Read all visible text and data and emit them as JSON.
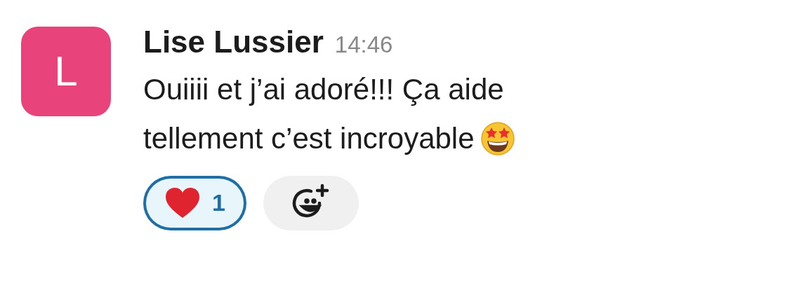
{
  "message": {
    "avatar_letter": "L",
    "author": "Lise Lussier",
    "time": "14:46",
    "text_lines": [
      "Ouiiii et j’ai adoré!!! Ça aide",
      "tellement c’est incroyable"
    ]
  },
  "reactions": [
    {
      "count": "1",
      "selected": true
    }
  ]
}
